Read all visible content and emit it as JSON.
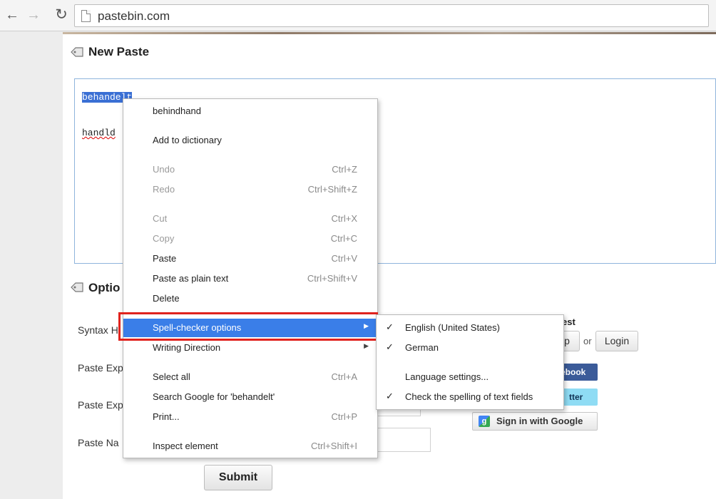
{
  "browser": {
    "url": "pastebin.com",
    "back_icon": "arrow-left-icon",
    "forward_icon": "arrow-right-icon",
    "reload_icon": "reload-icon"
  },
  "page": {
    "new_paste_title": "New Paste",
    "options_title": "Optio",
    "textarea_lines": [
      "behandelt",
      "handld"
    ],
    "form_labels": [
      "Syntax H",
      "Paste Exp",
      "Paste Exp",
      "Paste Na"
    ],
    "submit_label": "Submit",
    "guest_label": "est",
    "signup_label": "p",
    "or_label": "or",
    "login_label": "Login",
    "facebook_label": "ebook",
    "twitter_label": "tter",
    "google_label": "Sign in with Google",
    "google_icon_text": "g"
  },
  "context_menu": {
    "items": [
      {
        "label": "behindhand",
        "shortcut": ""
      },
      {
        "label": "Add to dictionary",
        "shortcut": ""
      },
      {
        "label": "Undo",
        "shortcut": "Ctrl+Z"
      },
      {
        "label": "Redo",
        "shortcut": "Ctrl+Shift+Z"
      },
      {
        "label": "Cut",
        "shortcut": "Ctrl+X"
      },
      {
        "label": "Copy",
        "shortcut": "Ctrl+C"
      },
      {
        "label": "Paste",
        "shortcut": "Ctrl+V"
      },
      {
        "label": "Paste as plain text",
        "shortcut": "Ctrl+Shift+V"
      },
      {
        "label": "Delete",
        "shortcut": ""
      },
      {
        "label": "Spell-checker options",
        "shortcut": ""
      },
      {
        "label": "Writing Direction",
        "shortcut": ""
      },
      {
        "label": "Select all",
        "shortcut": "Ctrl+A"
      },
      {
        "label": "Search Google for 'behandelt'",
        "shortcut": ""
      },
      {
        "label": "Print...",
        "shortcut": "Ctrl+P"
      },
      {
        "label": "Inspect element",
        "shortcut": "Ctrl+Shift+I"
      }
    ]
  },
  "spell_submenu": {
    "items": [
      {
        "label": "English (United States)",
        "checked": "✓"
      },
      {
        "label": "German",
        "checked": "✓"
      },
      {
        "label": "Language settings...",
        "checked": ""
      },
      {
        "label": "Check the spelling of text fields",
        "checked": "✓"
      }
    ]
  },
  "colors": {
    "menu_highlight": "#3a7ee8",
    "annotation_box": "#e0231e",
    "selection": "#3a6fd4"
  }
}
